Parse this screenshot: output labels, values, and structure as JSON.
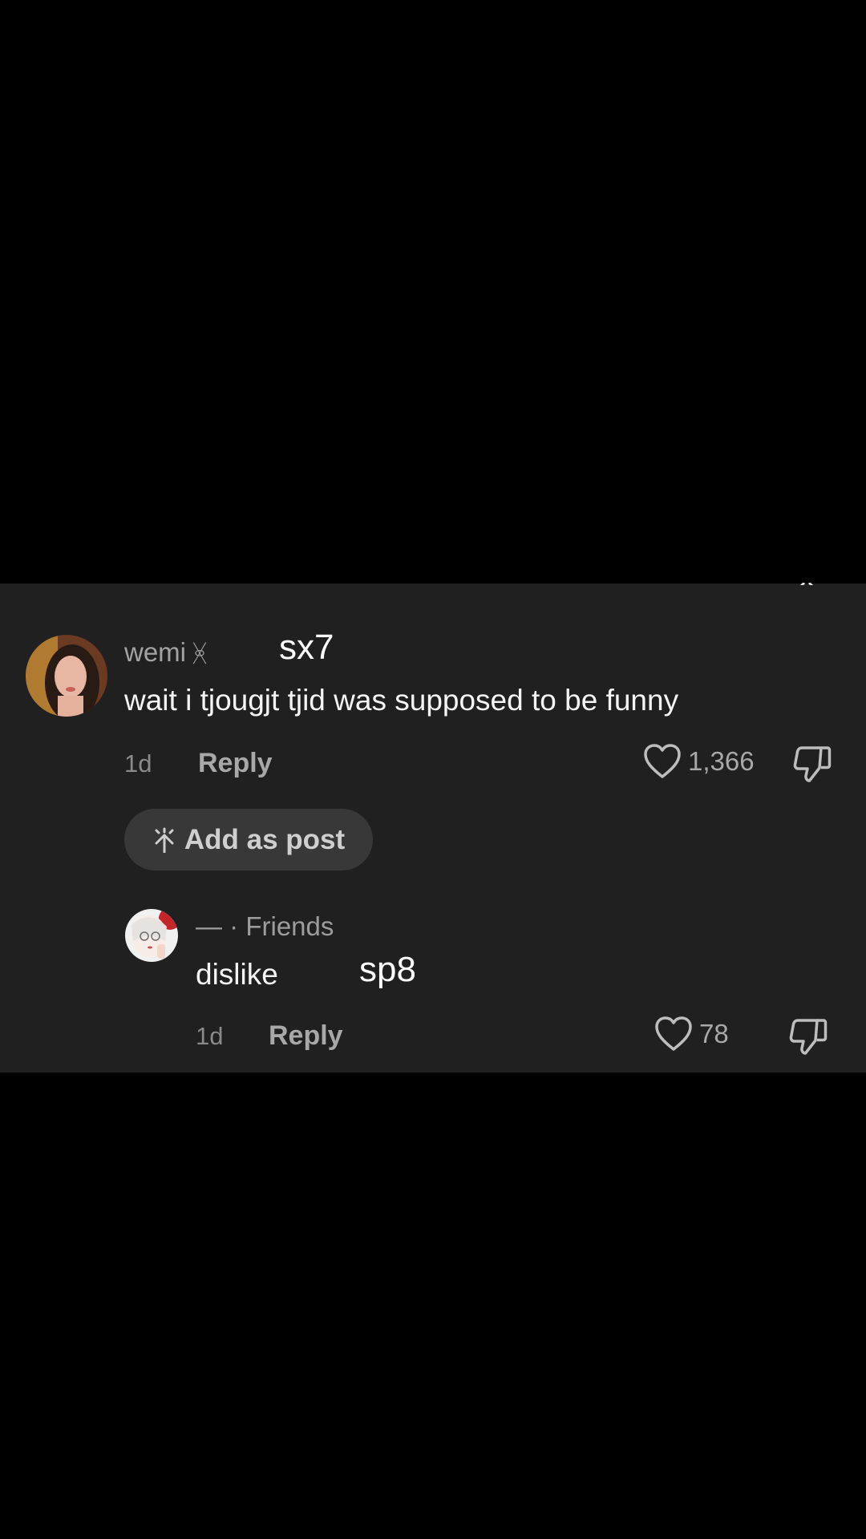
{
  "comments": [
    {
      "username": "wemi",
      "creator_mark": "ᚸ",
      "overlay": "sx7",
      "text": "wait i tjougjt tjid was supposed to be funny",
      "time": "1d",
      "reply_label": "Reply",
      "likes": "1,366",
      "add_post_label": "Add as post",
      "add_post_icon": "spark-icon"
    },
    {
      "username": "—",
      "separator": "·",
      "relation": "Friends",
      "overlay": "sp8",
      "text": "dislike",
      "time": "1d",
      "reply_label": "Reply",
      "likes": "78"
    }
  ],
  "colors": {
    "panel": "#202020",
    "background": "#000000",
    "muted_text": "#a3a3a3",
    "chip": "#383838"
  }
}
